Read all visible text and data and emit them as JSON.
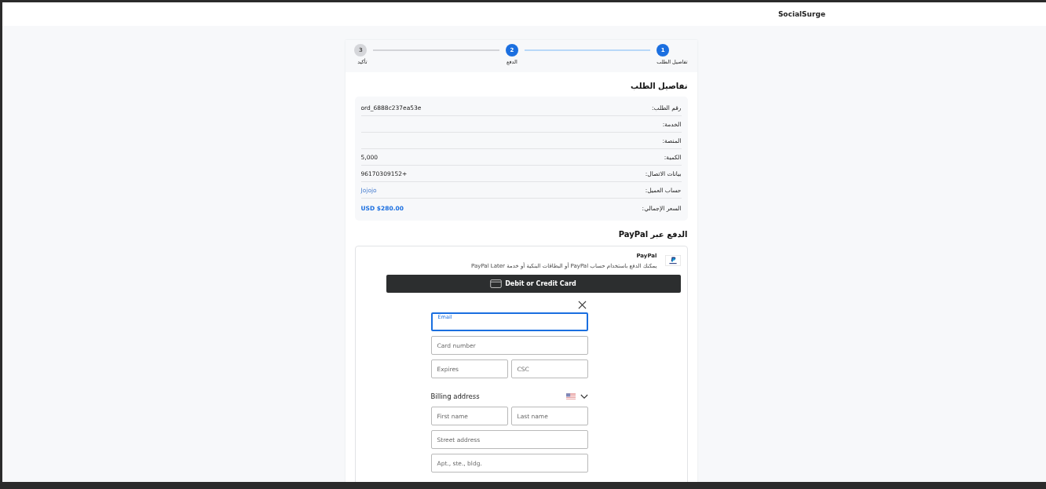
{
  "header": {
    "brand": "SocialSurge"
  },
  "steps": [
    {
      "number": "1",
      "label": "تفاصيل الطلب",
      "active": true
    },
    {
      "number": "2",
      "label": "الدفع",
      "active": true
    },
    {
      "number": "3",
      "label": "تأكيد",
      "active": false
    }
  ],
  "details": {
    "title": "تفاصيل الطلب",
    "rows": [
      {
        "label": "رقم الطلب:",
        "value": "ord_6888c237ea53e",
        "kind": "plain"
      },
      {
        "label": "الخدمة:"
      },
      {
        "label": "المنصة:"
      },
      {
        "label": "الكمية:",
        "value": "5,000",
        "kind": "plain"
      },
      {
        "label": "بيانات الاتصال:",
        "value": "96170309152+",
        "kind": "plain"
      },
      {
        "label": "حساب العميل:",
        "value": "Jojojo",
        "kind": "link"
      },
      {
        "label": "السعر الإجمالي:",
        "value": "USD $280.00",
        "kind": "total"
      }
    ]
  },
  "payment": {
    "title": "الدفع عبر PayPal",
    "provider": "PayPal",
    "description": "يمكنك الدفع باستخدام حساب PayPal أو البطاقات البنكية أو خدمة PayPal Later",
    "card_button": "Debit or Credit Card",
    "fields": {
      "email": {
        "label": "Email",
        "focused": true
      },
      "card_number": {
        "placeholder": "Card number",
        "focused": false
      },
      "expires": {
        "placeholder": "Expires",
        "focused": false
      },
      "csc": {
        "placeholder": "CSC",
        "focused": false
      },
      "billing_title": "Billing address",
      "first_name": {
        "placeholder": "First name",
        "focused": false
      },
      "last_name": {
        "placeholder": "Last name",
        "focused": false
      },
      "street_address": {
        "placeholder": "Street address",
        "focused": false
      },
      "apt": {
        "placeholder": "Apt., ste., bldg.",
        "focused": false
      }
    }
  }
}
